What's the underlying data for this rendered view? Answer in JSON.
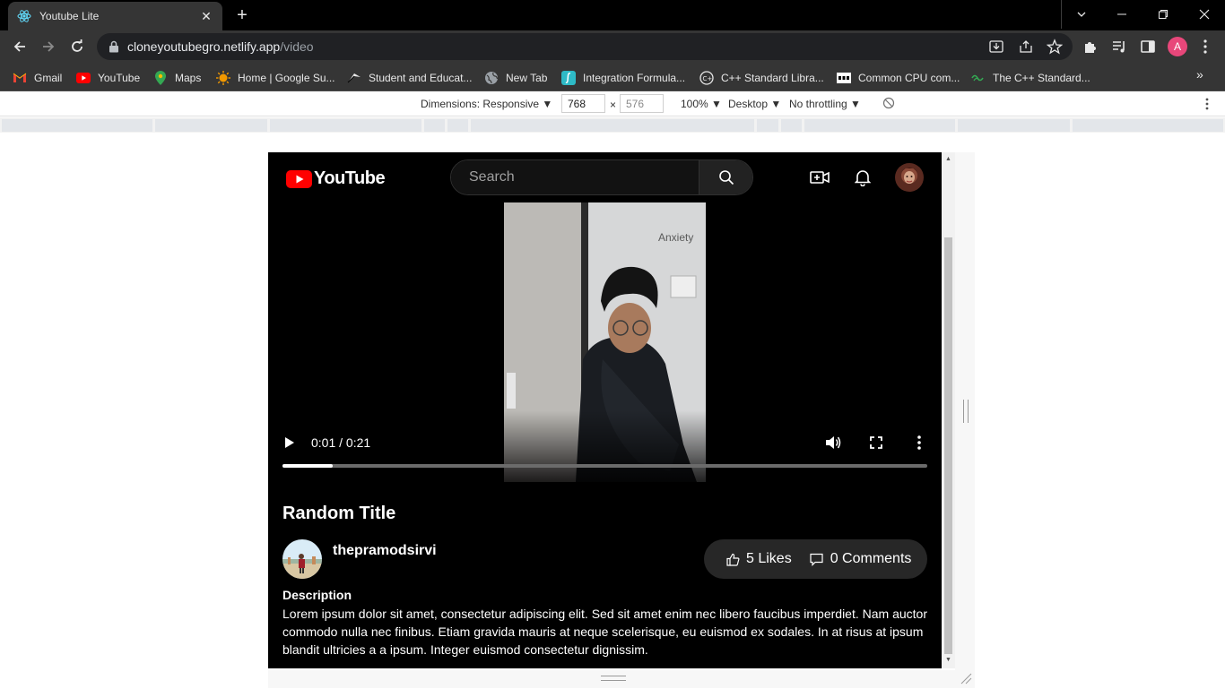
{
  "browser": {
    "tab_title": "Youtube Lite",
    "url_host": "cloneyoutubegro.netlify.app",
    "url_path": "/video",
    "profile_initial": "A",
    "bookmarks": [
      "Gmail",
      "YouTube",
      "Maps",
      "Home | Google Su...",
      "Student and Educat...",
      "New Tab",
      "Integration Formula...",
      "C++ Standard Libra...",
      "Common CPU com...",
      "The C++ Standard..."
    ]
  },
  "devtools": {
    "dimensions_label": "Dimensions: Responsive",
    "width_value": "768",
    "height_value": "576",
    "times_sign": "×",
    "zoom": "100%",
    "device_type": "Desktop",
    "throttling": "No throttling"
  },
  "youtube": {
    "logo_text": "YouTube",
    "search_placeholder": "Search",
    "video": {
      "overlay_caption": "Anxiety",
      "time_display": "0:01 / 0:21",
      "progress_fraction": 0.078
    },
    "title": "Random Title",
    "channel_name": "thepramodsirvi",
    "likes_label": "5 Likes",
    "comments_label": "0 Comments",
    "description_label": "Description",
    "description_text": "Lorem ipsum dolor sit amet, consectetur adipiscing elit. Sed sit amet enim nec libero faucibus imperdiet. Nam auctor commodo nulla nec finibus. Etiam gravida mauris at neque scelerisque, eu euismod ex sodales. In at risus at ipsum blandit ultricies a a ipsum. Integer euismod consectetur dignissim."
  },
  "colors": {
    "chrome_dark": "#353535",
    "yt_red": "#ff0000",
    "page_background": "#000000",
    "pill_background": "#272727",
    "profile_badge": "#e8477a"
  }
}
